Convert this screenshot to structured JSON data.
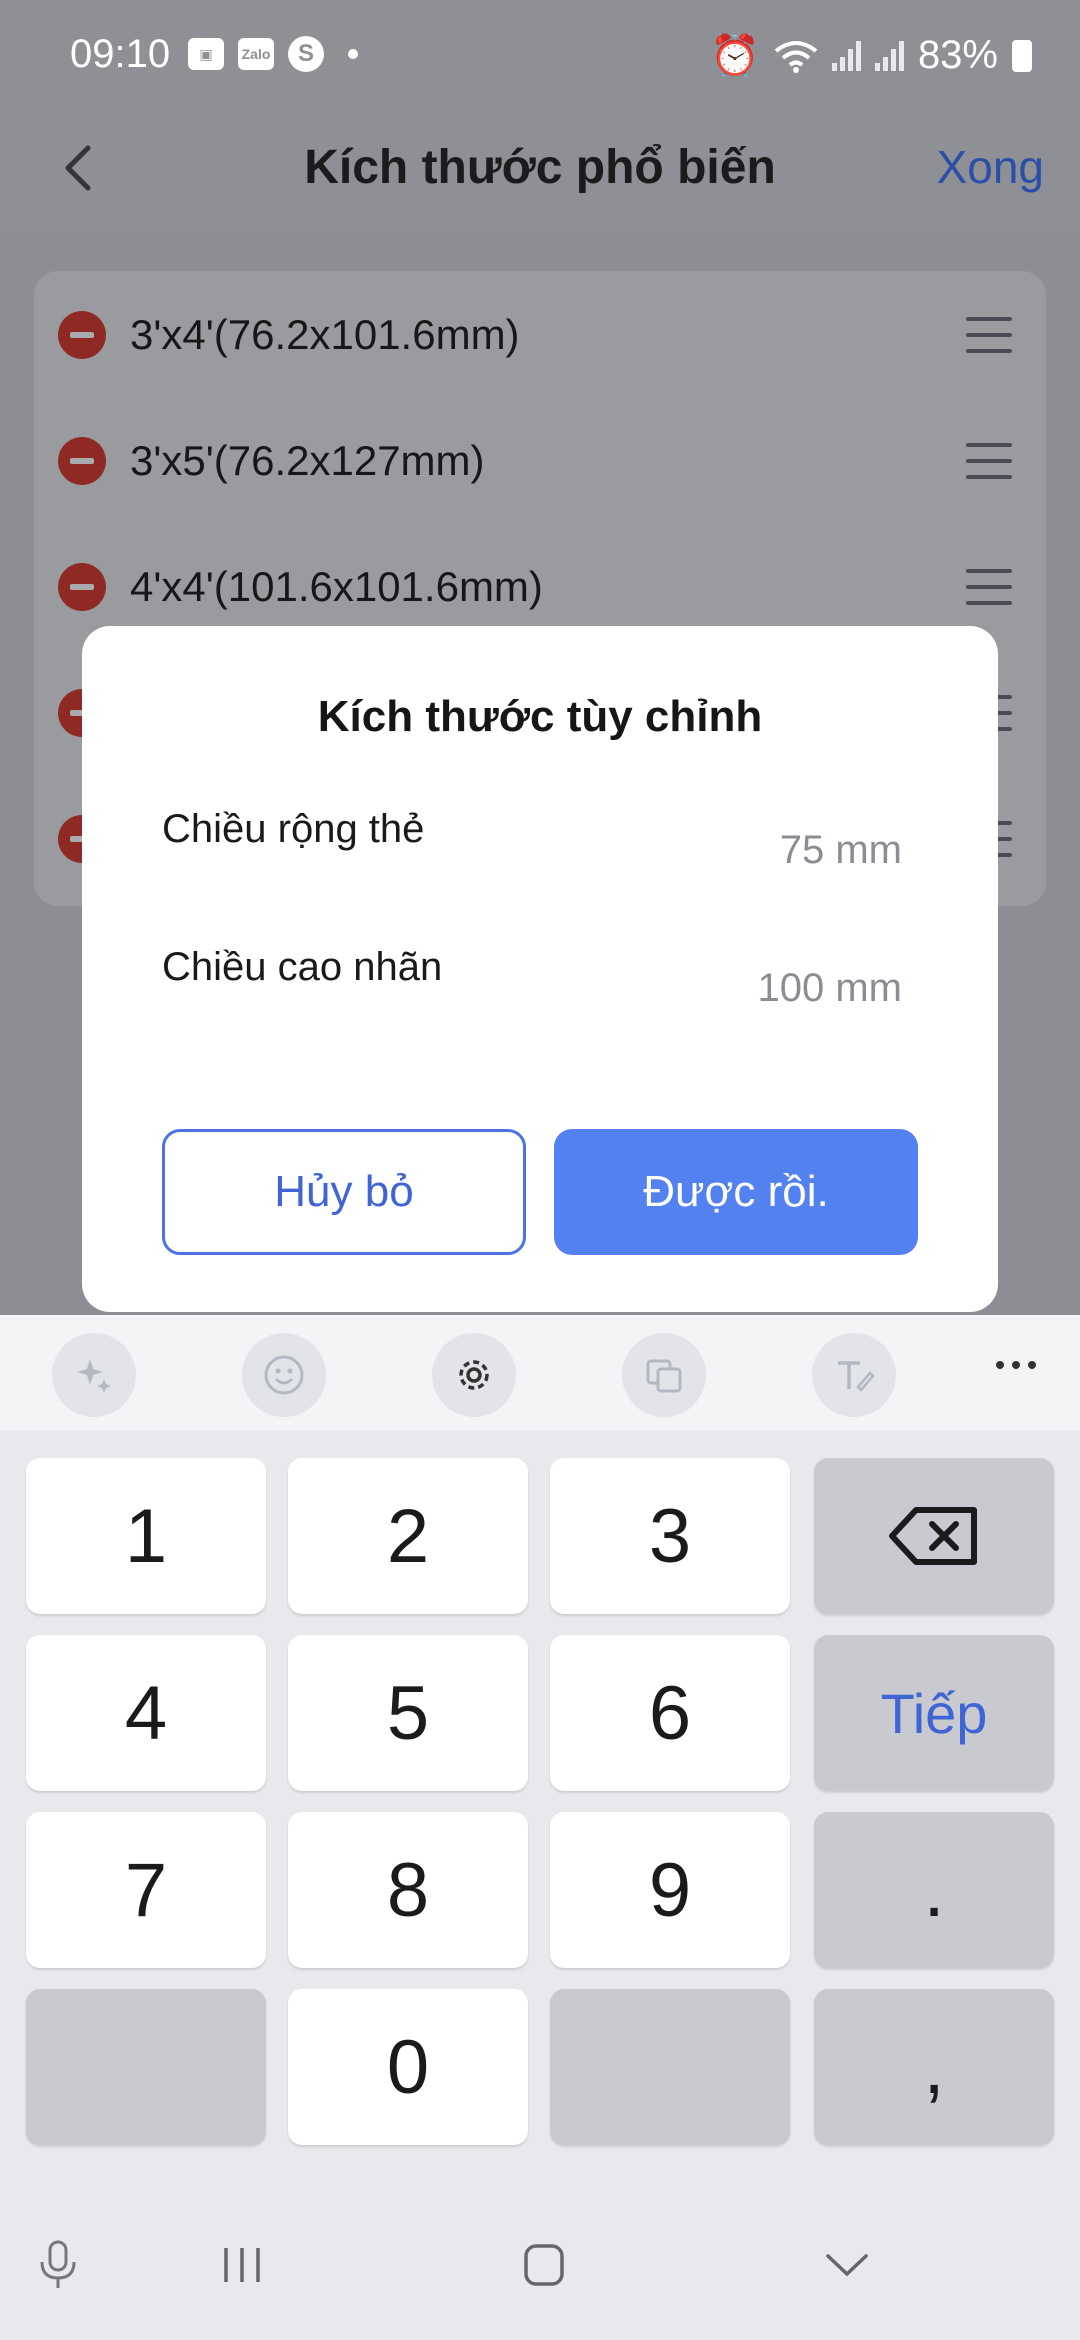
{
  "status_bar": {
    "time": "09:10",
    "zalo_label": "Zalo",
    "skype_label": "S",
    "battery": "83%"
  },
  "app_bar": {
    "title": "Kích thước phổ biến",
    "done_label": "Xong"
  },
  "size_list": [
    "3'x4'(76.2x101.6mm)",
    "3'x5'(76.2x127mm)",
    "4'x4'(101.6x101.6mm)",
    "",
    ""
  ],
  "dialog": {
    "title": "Kích thước tùy chỉnh",
    "width_label": "Chiều rộng thẻ",
    "width_value": "75 mm",
    "height_label": "Chiều cao nhãn",
    "height_value": "100 mm",
    "cancel_label": "Hủy bỏ",
    "ok_label": "Được rồi."
  },
  "keyboard": {
    "keys": [
      "1",
      "2",
      "3",
      "4",
      "5",
      "6",
      "7",
      "8",
      "9",
      "0"
    ],
    "next_label": "Tiếp",
    "dot_label": ".",
    "comma_label": ","
  },
  "colors": {
    "accent": "#5381f0",
    "danger": "#d14638",
    "overlay": "#8f9095"
  }
}
